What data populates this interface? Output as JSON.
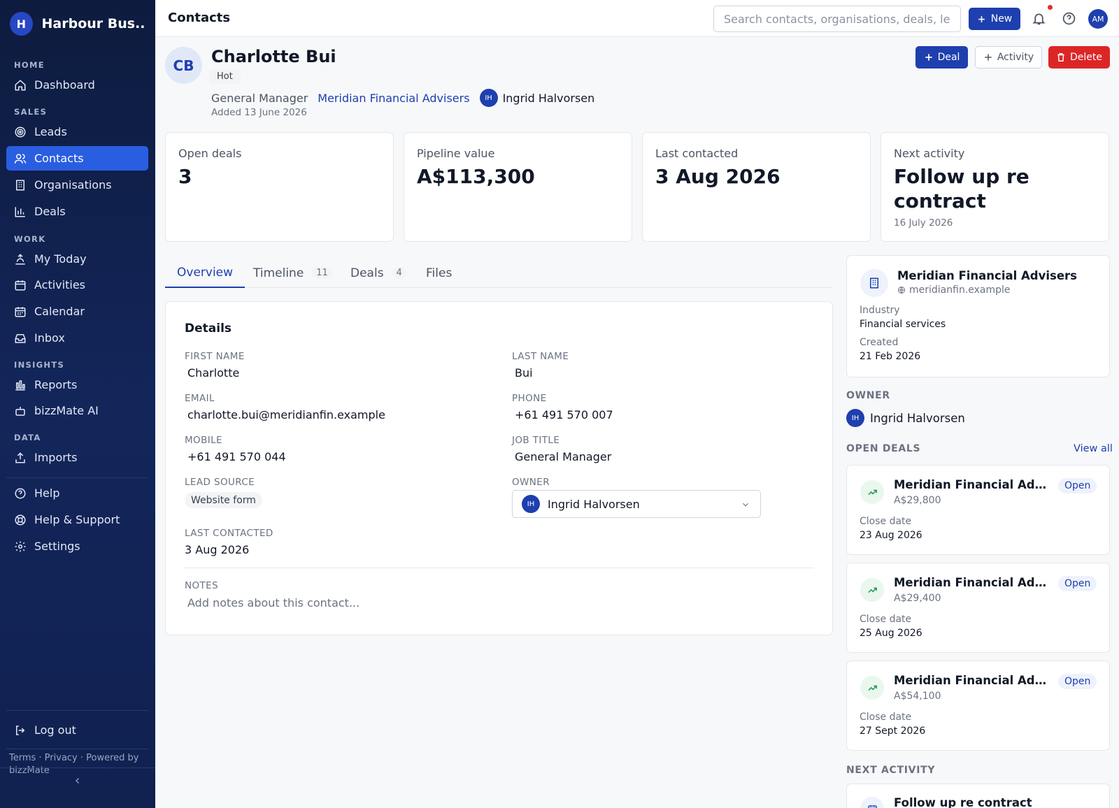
{
  "app": {
    "brand_initial": "H",
    "brand_name": "Harbour Bus..."
  },
  "sidebar": {
    "sections": {
      "home": "HOME",
      "sales": "SALES",
      "work": "WORK",
      "insights": "INSIGHTS",
      "data": "DATA"
    },
    "items": [
      {
        "label": "Dashboard",
        "icon": "home-icon"
      },
      {
        "label": "Leads",
        "icon": "target-icon"
      },
      {
        "label": "Contacts",
        "icon": "users-icon",
        "active": true
      },
      {
        "label": "Organisations",
        "icon": "building-icon"
      },
      {
        "label": "Deals",
        "icon": "bar-chart-icon"
      },
      {
        "label": "My Today",
        "icon": "sunrise-icon"
      },
      {
        "label": "Activities",
        "icon": "calendar-check-icon"
      },
      {
        "label": "Calendar",
        "icon": "calendar-icon"
      },
      {
        "label": "Inbox",
        "icon": "inbox-icon"
      },
      {
        "label": "Reports",
        "icon": "reports-icon"
      },
      {
        "label": "bizzMate AI",
        "icon": "bot-icon"
      },
      {
        "label": "Imports",
        "icon": "upload-icon"
      }
    ],
    "bottom_items": [
      {
        "label": "Help",
        "icon": "help-circle-icon"
      },
      {
        "label": "Help & Support",
        "icon": "lifebuoy-icon"
      },
      {
        "label": "Settings",
        "icon": "gear-icon"
      }
    ],
    "logout": "Log out",
    "footer": "Terms · Privacy · Powered by bizzMate"
  },
  "topbar": {
    "title": "Contacts",
    "search_placeholder": "Search contacts, organisations, deals, le",
    "new_label": "New",
    "user_initials": "AM"
  },
  "contact": {
    "initials": "CB",
    "name": "Charlotte Bui",
    "temperature": "Hot",
    "job_title": "General Manager",
    "organisation": "Meridian Financial Advisers",
    "owner_initials": "IH",
    "owner": "Ingrid Halvorsen",
    "added": "Added 13 June 2026",
    "actions": {
      "deal": "Deal",
      "activity": "Activity",
      "delete": "Delete"
    }
  },
  "stats": [
    {
      "label": "Open deals",
      "value": "3",
      "sub": ""
    },
    {
      "label": "Pipeline value",
      "value": "A$113,300",
      "sub": ""
    },
    {
      "label": "Last contacted",
      "value": "3 Aug 2026",
      "sub": ""
    },
    {
      "label": "Next activity",
      "value": "Follow up re contract",
      "sub": "16 July 2026"
    }
  ],
  "tabs": [
    {
      "label": "Overview",
      "count": "",
      "active": true
    },
    {
      "label": "Timeline",
      "count": "11"
    },
    {
      "label": "Deals",
      "count": "4"
    },
    {
      "label": "Files",
      "count": ""
    }
  ],
  "details": {
    "title": "Details",
    "first_name_label": "FIRST NAME",
    "first_name": "Charlotte",
    "last_name_label": "LAST NAME",
    "last_name": "Bui",
    "email_label": "EMAIL",
    "email": "charlotte.bui@meridianfin.example",
    "phone_label": "PHONE",
    "phone": "+61 491 570 007",
    "mobile_label": "MOBILE",
    "mobile": "+61 491 570 044",
    "job_title_label": "JOB TITLE",
    "job_title": "General Manager",
    "lead_source_label": "LEAD SOURCE",
    "lead_source": "Website form",
    "owner_label": "OWNER",
    "owner_initials": "IH",
    "owner": "Ingrid Halvorsen",
    "last_contacted_label": "LAST CONTACTED",
    "last_contacted": "3 Aug 2026",
    "notes_label": "NOTES",
    "notes_placeholder": "Add notes about this contact..."
  },
  "org_card": {
    "name": "Meridian Financial Advisers",
    "domain": "meridianfin.example",
    "industry_label": "Industry",
    "industry": "Financial services",
    "created_label": "Created",
    "created": "21 Feb 2026"
  },
  "owner_section": {
    "heading": "OWNER",
    "initials": "IH",
    "name": "Ingrid Halvorsen"
  },
  "open_deals": {
    "heading": "OPEN DEALS",
    "view_all": "View all",
    "close_label": "Close date",
    "items": [
      {
        "name": "Meridian Financial Advi...",
        "amount": "A$29,800",
        "status": "Open",
        "close_date": "23 Aug 2026"
      },
      {
        "name": "Meridian Financial Advi...",
        "amount": "A$29,400",
        "status": "Open",
        "close_date": "25 Aug 2026"
      },
      {
        "name": "Meridian Financial Advi...",
        "amount": "A$54,100",
        "status": "Open",
        "close_date": "27 Sept 2026"
      }
    ]
  },
  "next_activity": {
    "heading": "NEXT ACTIVITY",
    "title": "Follow up re contract"
  },
  "colors": {
    "primary": "#1e3fae",
    "danger": "#dc2626",
    "sidebar": "#0d1b3e",
    "active_nav": "#2a5ee0"
  }
}
